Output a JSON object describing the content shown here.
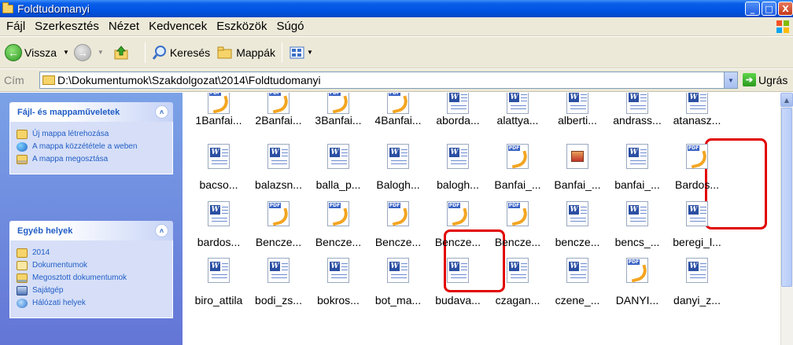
{
  "window": {
    "title": "Foldtudomanyi",
    "controls": [
      "_",
      "□",
      "X"
    ]
  },
  "menu": [
    "Fájl",
    "Szerkesztés",
    "Nézet",
    "Kedvencek",
    "Eszközök",
    "Súgó"
  ],
  "toolbar": {
    "back_label": "Vissza",
    "search_label": "Keresés",
    "folders_label": "Mappák"
  },
  "address": {
    "label": "Cím",
    "path": "D:\\Dokumentumok\\Szakdolgozat\\2014\\Foldtudomanyi",
    "go_label": "Ugrás"
  },
  "taskpane": {
    "file_tasks": {
      "title": "Fájl- és mappaműveletek",
      "items": [
        "Új mappa létrehozása",
        "A mappa közzététele a weben",
        "A mappa megosztása"
      ]
    },
    "other_places": {
      "title": "Egyéb helyek",
      "items": [
        "2014",
        "Dokumentumok",
        "Megosztott dokumentumok",
        "Sajátgép",
        "Hálózati helyek"
      ]
    }
  },
  "files": [
    [
      {
        "name": "1Banfai...",
        "type": "pdf"
      },
      {
        "name": "2Banfai...",
        "type": "pdf"
      },
      {
        "name": "3Banfai...",
        "type": "pdf"
      },
      {
        "name": "4Banfai...",
        "type": "pdf"
      },
      {
        "name": "aborda...",
        "type": "doc"
      },
      {
        "name": "alattya...",
        "type": "doc"
      },
      {
        "name": "alberti...",
        "type": "doc"
      },
      {
        "name": "andrass...",
        "type": "doc"
      },
      {
        "name": "atanasz...",
        "type": "doc"
      }
    ],
    [
      {
        "name": "bacso...",
        "type": "doc"
      },
      {
        "name": "balazsn...",
        "type": "doc"
      },
      {
        "name": "balla_p...",
        "type": "doc"
      },
      {
        "name": "Balogh...",
        "type": "doc"
      },
      {
        "name": "balogh...",
        "type": "doc"
      },
      {
        "name": "Banfai_...",
        "type": "pdf"
      },
      {
        "name": "Banfai_...",
        "type": "img"
      },
      {
        "name": "banfai_...",
        "type": "doc"
      },
      {
        "name": "Bardos...",
        "type": "pdf"
      }
    ],
    [
      {
        "name": "bardos...",
        "type": "doc"
      },
      {
        "name": "Bencze...",
        "type": "pdf"
      },
      {
        "name": "Bencze...",
        "type": "pdf"
      },
      {
        "name": "Bencze...",
        "type": "pdf"
      },
      {
        "name": "Bencze...",
        "type": "pdf"
      },
      {
        "name": "Bencze...",
        "type": "pdf"
      },
      {
        "name": "bencze...",
        "type": "doc"
      },
      {
        "name": "bencs_...",
        "type": "doc"
      },
      {
        "name": "beregi_l...",
        "type": "doc"
      }
    ],
    [
      {
        "name": "biro_attila",
        "type": "doc"
      },
      {
        "name": "bodi_zs...",
        "type": "doc"
      },
      {
        "name": "bokros...",
        "type": "doc"
      },
      {
        "name": "bot_ma...",
        "type": "doc"
      },
      {
        "name": "budava...",
        "type": "doc"
      },
      {
        "name": "czagan...",
        "type": "doc"
      },
      {
        "name": "czene_...",
        "type": "doc"
      },
      {
        "name": "DANYI...",
        "type": "pdf"
      },
      {
        "name": "danyi_z...",
        "type": "doc"
      }
    ]
  ]
}
